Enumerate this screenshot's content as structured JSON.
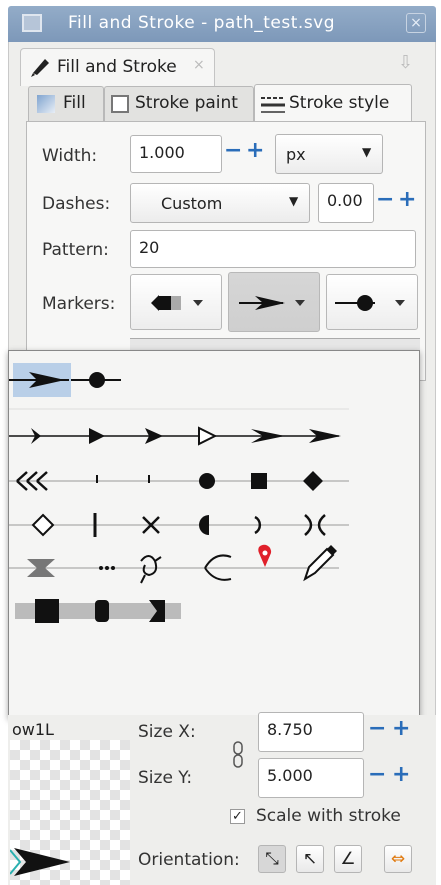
{
  "window": {
    "title": "Fill and Stroke - path_test.svg",
    "close_glyph": "×"
  },
  "doc_tab": {
    "label": "Fill and Stroke",
    "close_glyph": "×"
  },
  "tabs": [
    {
      "label": "Fill",
      "icon": "fill-icon"
    },
    {
      "label": "Stroke paint",
      "icon": "stroke-paint-icon"
    },
    {
      "label": "Stroke style",
      "icon": "stroke-style-icon",
      "active": true
    }
  ],
  "stroke_style": {
    "width_label": "Width:",
    "width_value": "1.000",
    "width_unit": "px",
    "dashes_label": "Dashes:",
    "dashes_value": "Custom",
    "dash_offset": "0.00",
    "pattern_label": "Pattern:",
    "pattern_value": "20",
    "markers_label": "Markers:",
    "minus": "−",
    "plus": "+"
  },
  "marker_popup": {
    "truncated_name": "ow1L",
    "size_x_label": "Size X:",
    "size_x_value": "8.750",
    "size_y_label": "Size Y:",
    "size_y_value": "5.000",
    "scale_label": "Scale with stroke",
    "scale_checked": true,
    "orientation_label": "Orientation:"
  },
  "colors": {
    "accent": "#2a6db9",
    "titlebar": "#8aa4c4",
    "marker_red": "#e0202a",
    "selection": "#b9cfe8"
  }
}
